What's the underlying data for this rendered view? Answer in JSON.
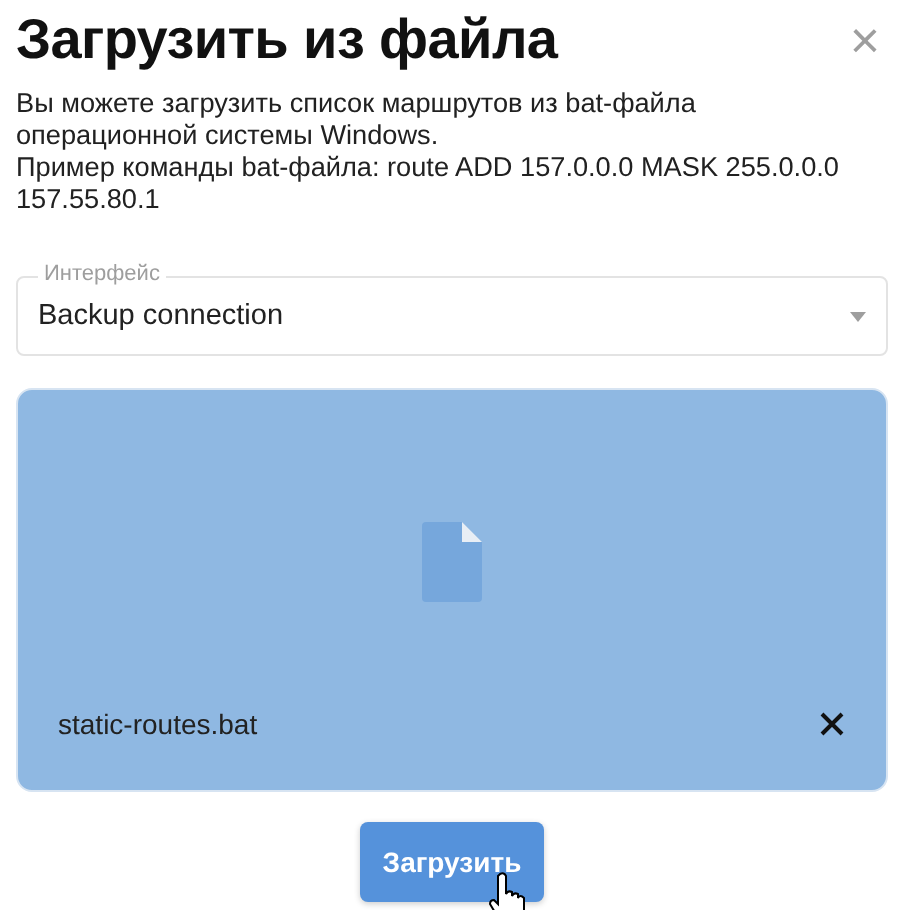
{
  "dialog": {
    "title": "Загрузить из файла",
    "close": "×",
    "description": [
      "Вы можете загрузить список маршрутов из bat-файла операционной системы Windows.",
      "Пример команды bat-файла: route ADD 157.0.0.0 MASK 255.0.0.0 157.55.80.1"
    ],
    "interface_field": {
      "label": "Интерфейс",
      "value": "Backup connection"
    },
    "file": {
      "name": "static-routes.bat"
    },
    "submit": {
      "label": "Загрузить"
    }
  }
}
